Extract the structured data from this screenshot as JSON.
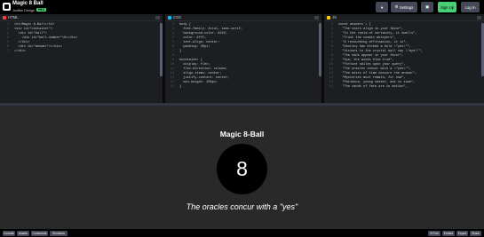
{
  "header": {
    "title": "Magic 8 Ball",
    "author": "Juditta Design",
    "badge": "PRO",
    "buttons": {
      "heart": "♥",
      "settings": "Settings",
      "layout": "▣",
      "signup": "Sign Up",
      "login": "Log In"
    },
    "settings_icon": "gear-icon"
  },
  "panes": {
    "html": {
      "label": "HTML",
      "color": "#ff3c41"
    },
    "css": {
      "label": "CSS",
      "color": "#0ebeff"
    },
    "js": {
      "label": "JS",
      "color": "#fcd000"
    }
  },
  "code_html": [
    "<h1>Magic 8-Ball</h1>",
    "<div id=\"container\">",
    "  <div id=\"ball\">",
    "    <div id=\"ball-number\">8</div>",
    "  </div>",
    "  <div id=\"answer\"></div>",
    "</div>"
  ],
  "code_css": [
    "body {",
    "  font-family: Arial, sans-serif;",
    "  background-color: #222;",
    "  color: #fff;",
    "  text-align: center;",
    "  padding: 20px;",
    "}",
    "",
    "#container {",
    "  display: flex;",
    "  flex-direction: column;",
    "  align-items: center;",
    "  justify-content: center;",
    "  min-height: 200px;",
    "}"
  ],
  "code_js": [
    "const answers = [",
    "  \"The stars align in your favor\",",
    "  \"In the realm of certainty, it dwells\",",
    "  \"Trust the cosmic whispers\",",
    "  \"A resounding affirmation, it is\",",
    "  \"Destiny has etched a bold \\\"yes\\\"\",",
    "  \"Visions in the crystal ball say \\\"aye\\\"\",",
    "  \"The odds appear in your favor\",",
    "  \"Aye, the winds blow true\",",
    "  \"Fortune smiles upon your query\",",
    "  \"The oracles concur with a \\\"yes\\\"\",",
    "  \"The mists of time obscure the answer\",",
    "  \"Mysteries must remain, for now\",",
    "  \"Patience, young seeker, ask in time\",",
    "  \"The sands of fate are in motion\","
  ],
  "preview": {
    "heading": "Magic 8-Ball",
    "ball_number": "8",
    "answer": "The oracles concur with a \"yes\""
  },
  "footer": {
    "left": [
      "Console",
      "Assets",
      "Comments",
      "Shortcuts"
    ],
    "right": [
      "⟲ Fork",
      "Embed",
      "Export",
      "Share"
    ]
  }
}
